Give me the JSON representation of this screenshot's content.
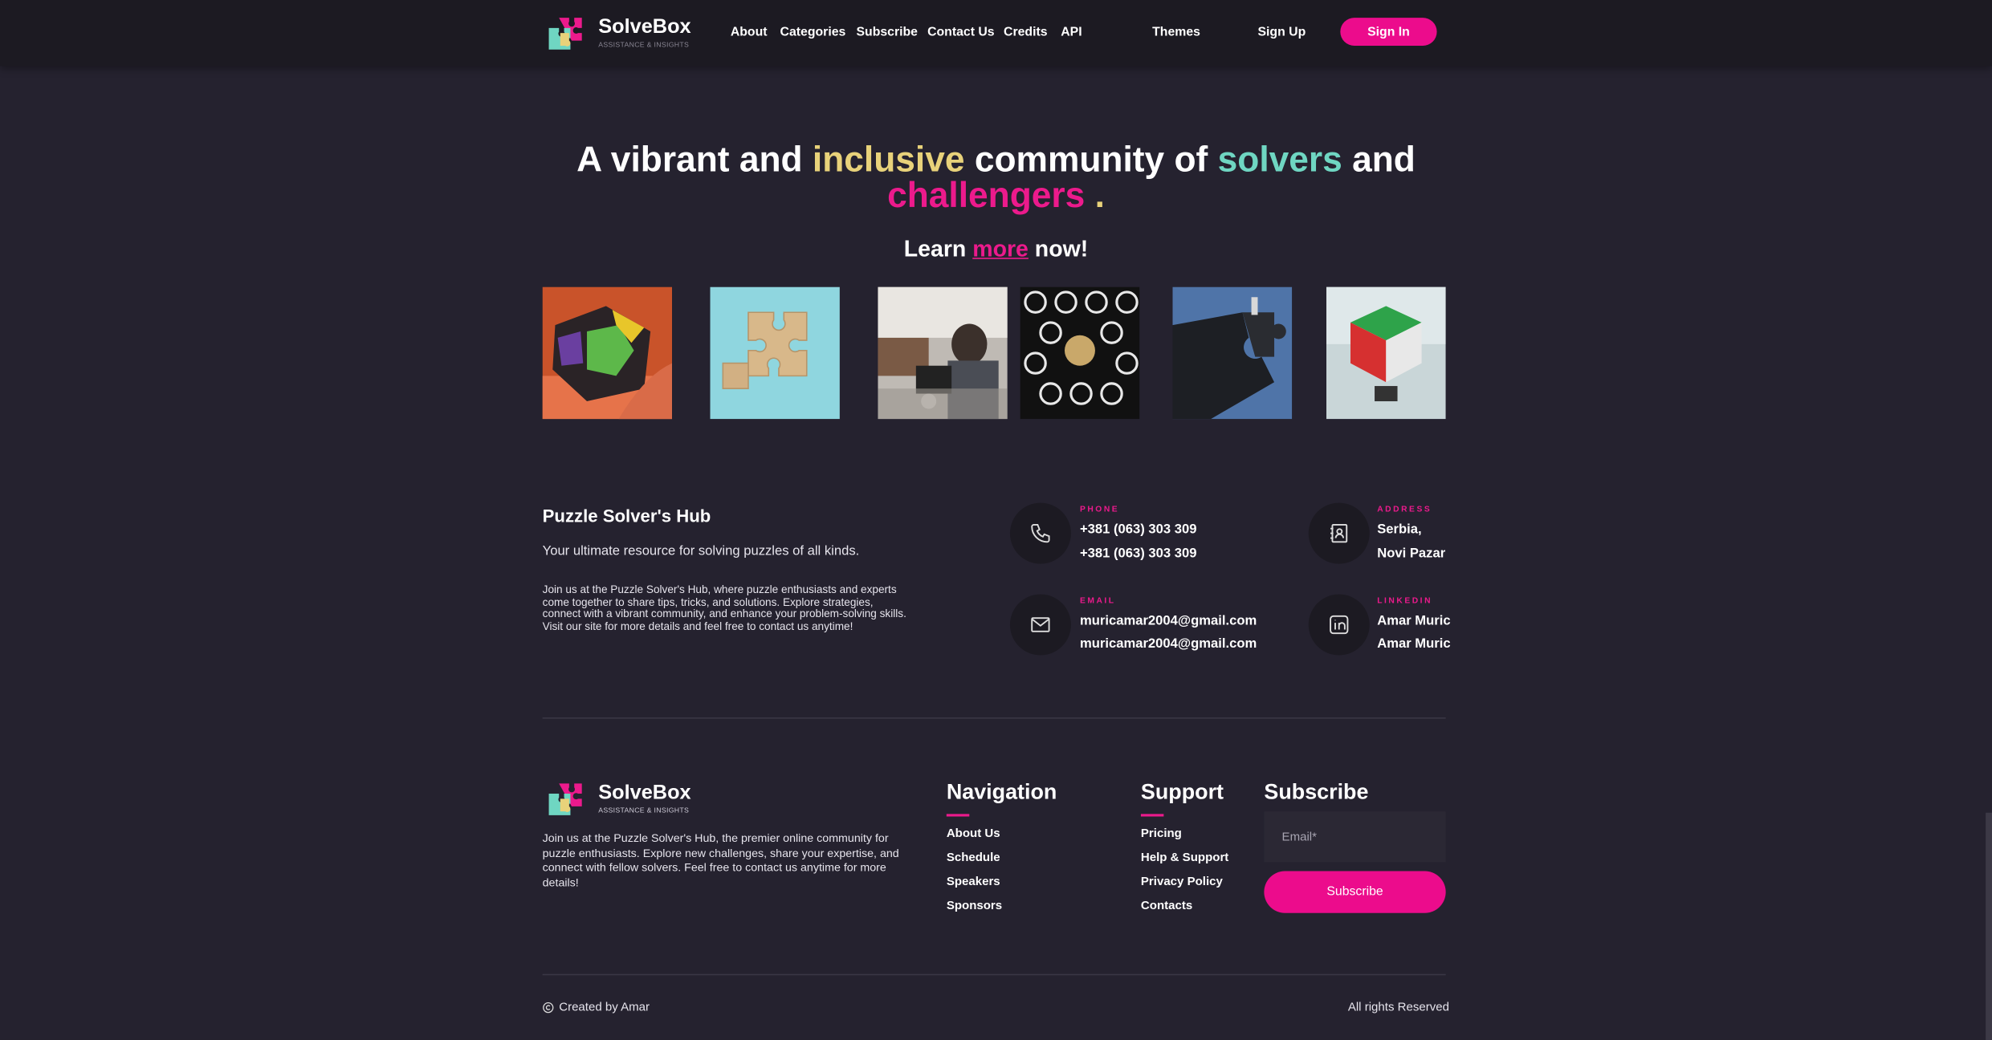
{
  "header": {
    "brand": "SolveBox",
    "tagline": "ASSISTANCE & INSIGHTS",
    "nav": [
      "About",
      "Categories",
      "Subscribe",
      "Contact Us",
      "Credits",
      "API"
    ],
    "themes": "Themes",
    "signup": "Sign Up",
    "signin": "Sign In"
  },
  "hero": {
    "line1": {
      "a": "A vibrant and ",
      "b": "inclusive",
      "c": " community of ",
      "d": "solvers",
      "e": " and"
    },
    "line2": {
      "a": "challengers",
      "b": " ."
    },
    "learn": {
      "a": "Learn ",
      "link": "more",
      "b": " now!"
    }
  },
  "gallery": {
    "images": [
      "megaminx-puzzle",
      "wooden-jigsaw-pieces",
      "person-at-laptop",
      "brain-head-pattern",
      "dark-puzzle-piece",
      "rubiks-cube"
    ]
  },
  "info": {
    "title": "Puzzle Solver's Hub",
    "subtitle": "Your ultimate resource for solving puzzles of all kinds.",
    "description": "Join us at the Puzzle Solver's Hub, where puzzle enthusiasts and experts come together to share tips, tricks, and solutions. Explore strategies, connect with a vibrant community, and enhance your problem-solving skills. Visit our site for more details and feel free to contact us anytime!",
    "phone": {
      "label": "PHONE",
      "values": [
        "+381 (063) 303 309",
        "+381 (063) 303 309"
      ]
    },
    "address": {
      "label": "ADDRESS",
      "values": [
        "Serbia,",
        "Novi Pazar"
      ]
    },
    "email": {
      "label": "EMAIL",
      "values": [
        "muricamar2004@gmail.com",
        "muricamar2004@gmail.com"
      ]
    },
    "linkedin": {
      "label": "LINKEDIN",
      "values": [
        "Amar Muric",
        "Amar Muric"
      ]
    }
  },
  "footer": {
    "brand": "SolveBox",
    "tagline": "ASSISTANCE & INSIGHTS",
    "description": "Join us at the Puzzle Solver's Hub, the premier online community for puzzle enthusiasts. Explore new challenges, share your expertise, and connect with fellow solvers. Feel free to contact us anytime for more details!",
    "navigation": {
      "title": "Navigation",
      "links": [
        "About Us",
        "Schedule",
        "Speakers",
        "Sponsors"
      ]
    },
    "support": {
      "title": "Support",
      "links": [
        "Pricing",
        "Help & Support",
        "Privacy Policy",
        "Contacts"
      ]
    },
    "subscribe": {
      "title": "Subscribe",
      "placeholder": "Email*",
      "button": "Subscribe"
    },
    "created": "Created by Amar",
    "rights": "All rights Reserved"
  },
  "colors": {
    "accent": "#ec0c8c",
    "yellow": "#e8d27a",
    "teal": "#6fd6c2",
    "background": "#25222f"
  }
}
